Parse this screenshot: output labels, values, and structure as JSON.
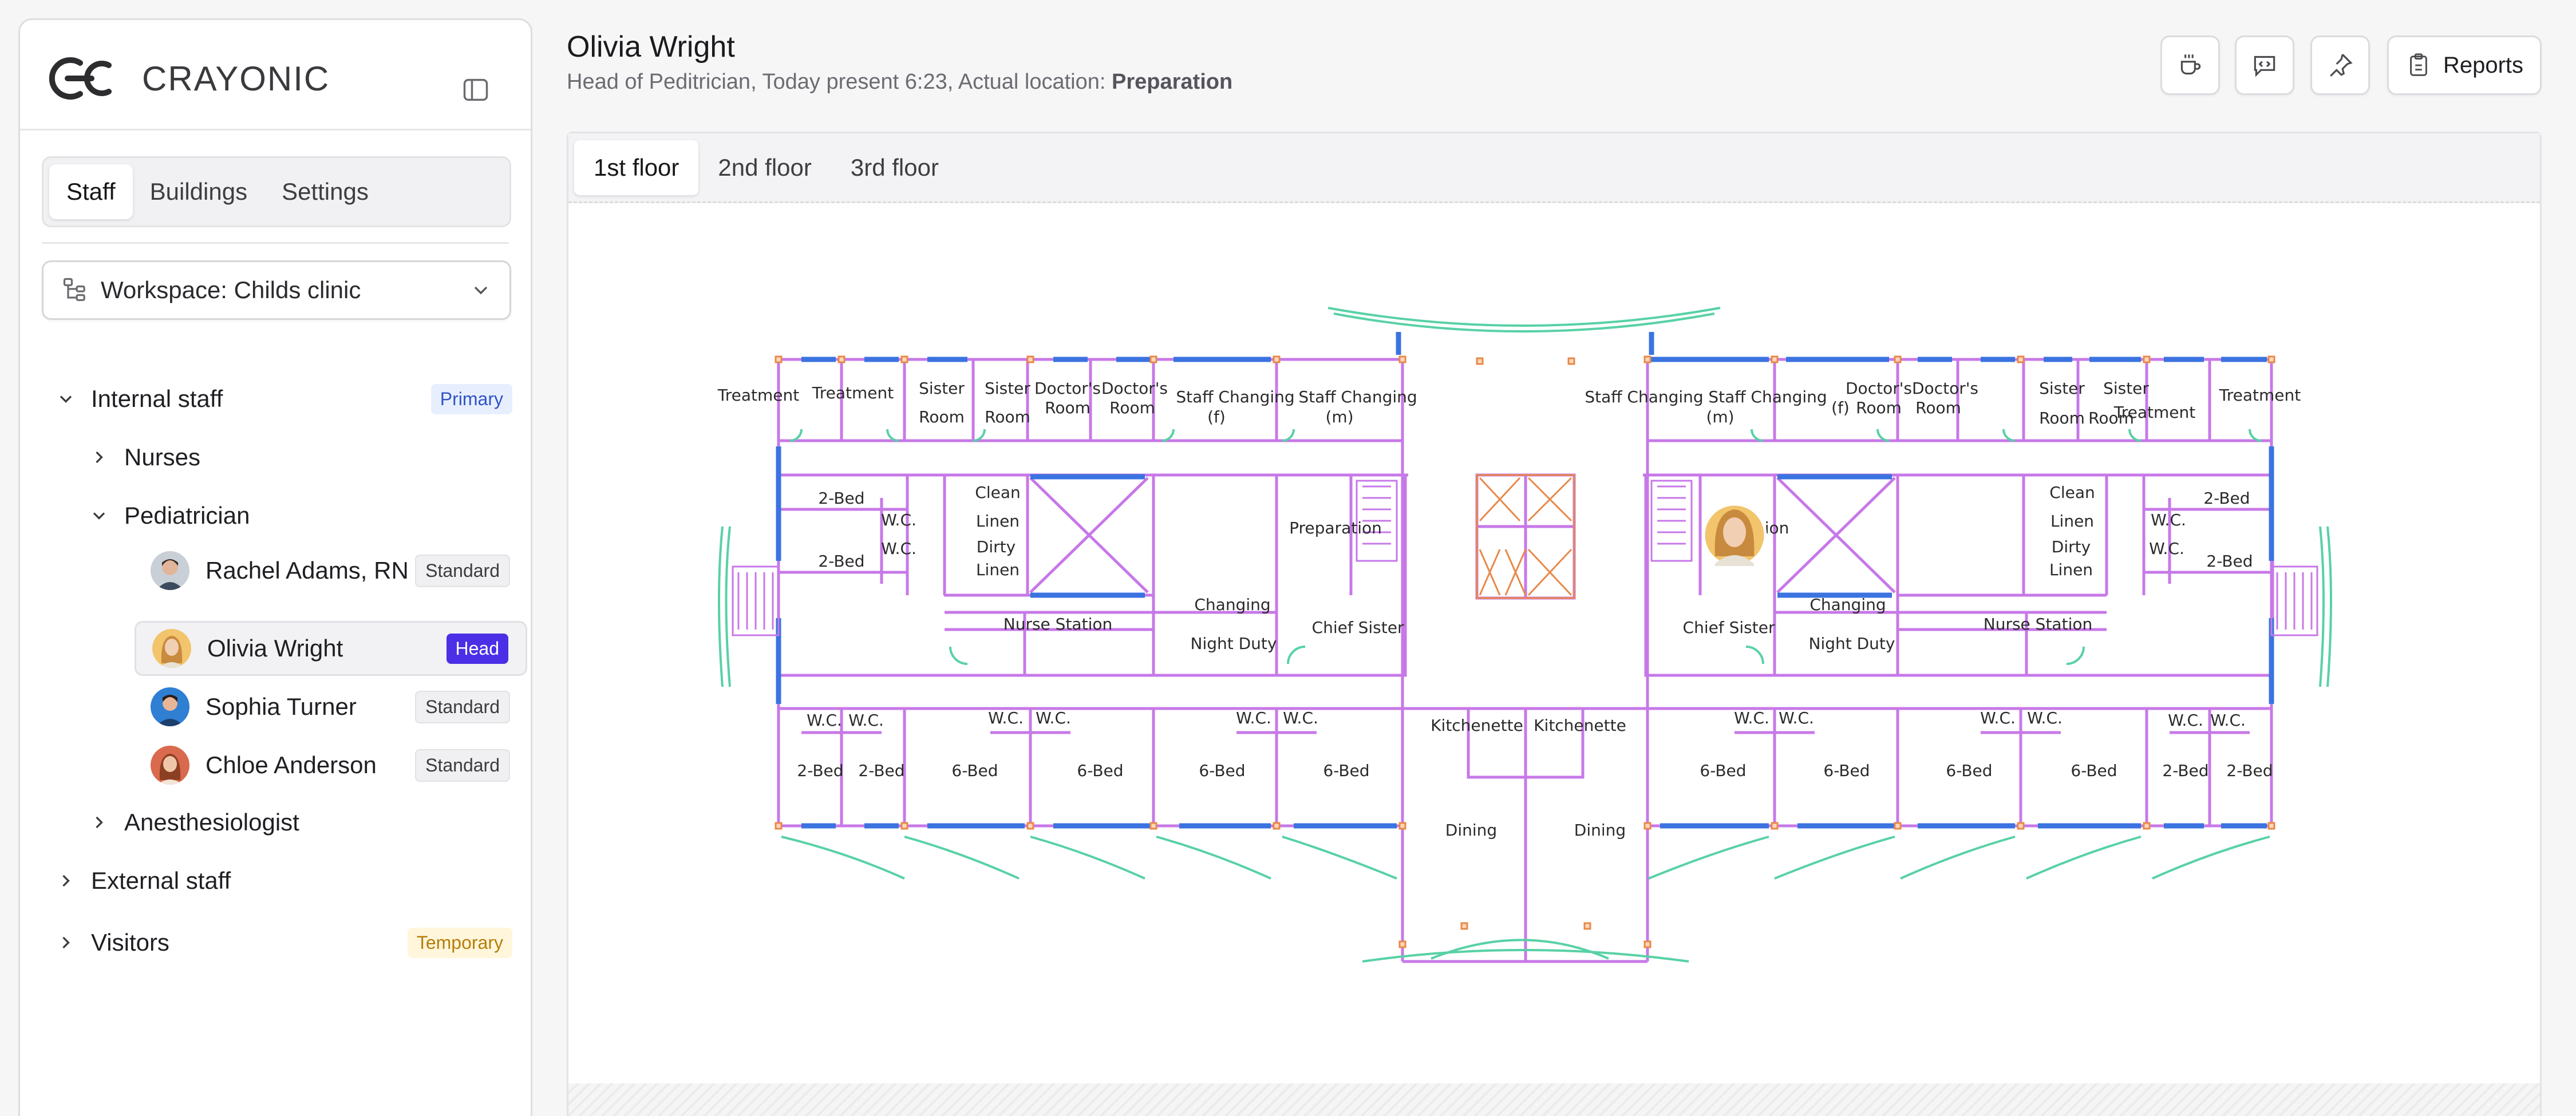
{
  "brand": {
    "name": "CRAYONIC"
  },
  "sidebar": {
    "tabs": [
      {
        "label": "Staff",
        "active": true
      },
      {
        "label": "Buildings"
      },
      {
        "label": "Settings"
      }
    ],
    "workspace": {
      "label": "Workspace: Childs clinic"
    },
    "groups": {
      "internal": {
        "label": "Internal staff",
        "badge": "Primary",
        "expanded": true
      },
      "nurses": {
        "label": "Nurses",
        "expanded": false
      },
      "pediatrician": {
        "label": "Pediatrician",
        "expanded": true
      },
      "anesthesiologist": {
        "label": "Anesthesiologist",
        "expanded": false
      },
      "external": {
        "label": "External staff",
        "expanded": false
      },
      "visitors": {
        "label": "Visitors",
        "badge": "Temporary",
        "expanded": false
      }
    },
    "people": [
      {
        "name": "Rachel Adams, RN",
        "role": "Standard"
      },
      {
        "name": "Olivia Wright",
        "role": "Head",
        "selected": true
      },
      {
        "name": "Sophia Turner",
        "role": "Standard"
      },
      {
        "name": "Chloe Anderson",
        "role": "Standard"
      }
    ]
  },
  "header": {
    "name": "Olivia Wright",
    "subtitle_prefix": "Head of Peditrician, Today present 6:23, Actual location: ",
    "location": "Preparation",
    "reports_label": "Reports",
    "icons": [
      "coffee-icon",
      "chat-code-icon",
      "pin-icon",
      "clipboard-icon"
    ]
  },
  "floors": {
    "tabs": [
      {
        "label": "1st floor",
        "active": true
      },
      {
        "label": "2nd floor"
      },
      {
        "label": "3rd floor"
      }
    ]
  },
  "floorplan": {
    "left_wing": {
      "top": [
        "Treatment",
        "Treatment",
        "Sister",
        "Room",
        "Sister",
        "Room",
        "Doctor's",
        "Room",
        "Doctor's",
        "Room",
        "Staff Changing",
        "(f)",
        "Staff Changing",
        "(m)"
      ],
      "mid": [
        "2-Bed",
        "W.C.",
        "W.C.",
        "2-Bed",
        "Clean",
        "Linen",
        "Dirty",
        "Linen",
        "Preparation",
        "Nurse Station",
        "Changing",
        "Night Duty",
        "Chief Sister"
      ],
      "bottom": [
        "W.C.",
        "W.C.",
        "W.C.",
        "W.C.",
        "W.C.",
        "W.C.",
        "2-Bed",
        "2-Bed",
        "6-Bed",
        "6-Bed",
        "6-Bed",
        "6-Bed"
      ]
    },
    "center": [
      "Kitchenette",
      "Kitchenette",
      "Dining",
      "Dining"
    ],
    "right_wing": {
      "top": [
        "Staff Changing",
        "Staff Changing",
        "(m)",
        "(f)",
        "Doctor's",
        "Room",
        "Doctor's",
        "Room",
        "Sister",
        "Room",
        "Sister",
        "Room",
        "Treatment",
        "Treatment"
      ],
      "mid": [
        "ation",
        "Clean",
        "Linen",
        "Dirty",
        "Linen",
        "W.C.",
        "W.C.",
        "2-Bed",
        "2-Bed",
        "Changing",
        "Night Duty",
        "Chief Sister",
        "Nurse Station"
      ],
      "bottom": [
        "W.C.",
        "W.C.",
        "W.C.",
        "W.C.",
        "W.C.",
        "W.C.",
        "6-Bed",
        "6-Bed",
        "6-Bed",
        "6-Bed",
        "2-Bed",
        "2-Bed"
      ]
    },
    "marker_person": "Olivia Wright",
    "colors": {
      "wall": "#c778e8",
      "window": "#3b73e0",
      "door": "#58d1a5",
      "column": "#e8894a"
    }
  }
}
